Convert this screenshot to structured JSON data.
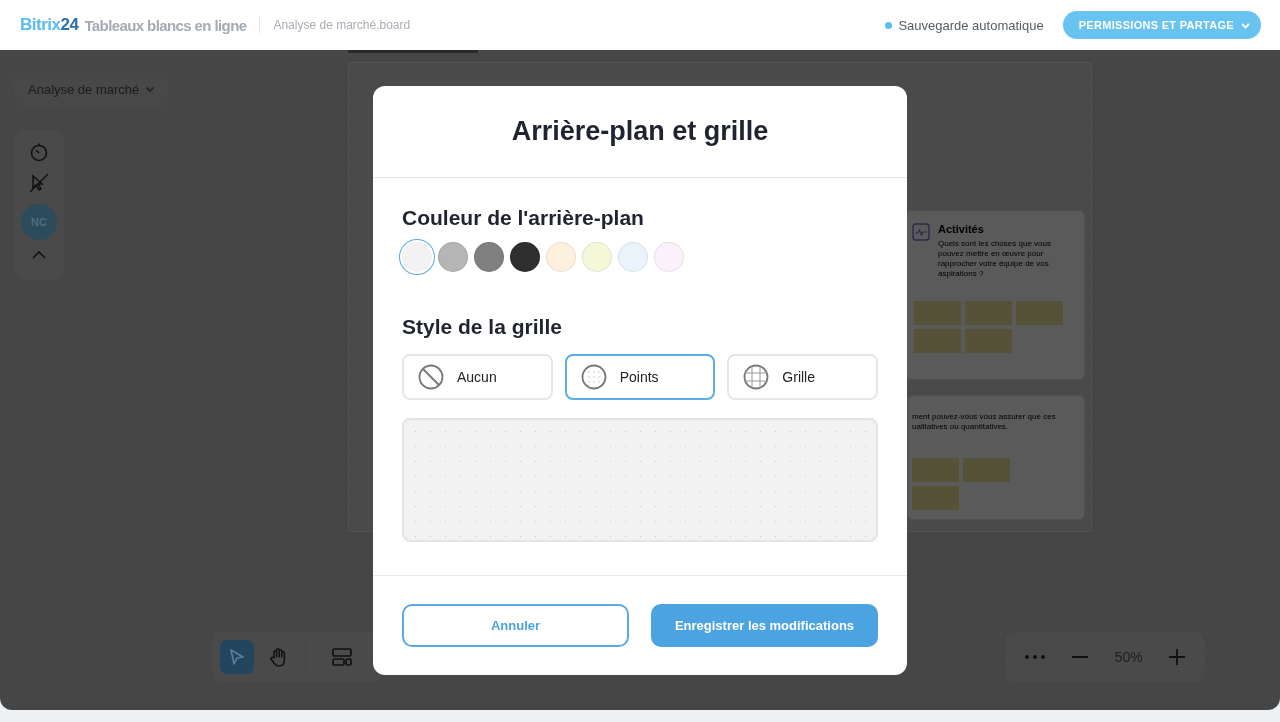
{
  "header": {
    "logo": {
      "brand": "Bitrix",
      "number": "24"
    },
    "app_name": "Tableaux blancs en ligne",
    "file_name": "Analyse de marché.board",
    "save_status": {
      "label": "Sauvegarde automatique",
      "color": "#5bc0f0"
    },
    "share_button": "PERMISSIONS ET PARTAGE"
  },
  "board": {
    "title": "Analyse de marché",
    "avatar": "NC",
    "zoom": "50%",
    "tools": [
      {
        "kind": "select",
        "selected": true
      },
      {
        "kind": "hand",
        "selected": false
      },
      {
        "kind": "layout",
        "selected": false
      }
    ],
    "cards": [
      {
        "title": "Activités",
        "text": "Quels sont les choses que vous pouvez mettre en œuvre pour rapprocher votre équipe de vos aspirations ?"
      },
      {
        "text_lines": [
          "ment pouvez-vous vous assurer que ces",
          "ualitatives ou quantitatives."
        ]
      }
    ]
  },
  "dialog": {
    "title": "Arrière-plan et grille",
    "background": {
      "heading": "Couleur de l'arrière-plan",
      "colors": [
        {
          "color": "#f2f2f2",
          "selected": true
        },
        {
          "color": "#b5b5b5",
          "selected": false
        },
        {
          "color": "#808080",
          "selected": false
        },
        {
          "color": "#2e2e2e",
          "selected": false
        },
        {
          "color": "#fdf0dd",
          "selected": false
        },
        {
          "color": "#f5f7d9",
          "selected": false
        },
        {
          "color": "#eaf3fc",
          "selected": false
        },
        {
          "color": "#fbf1fa",
          "selected": false
        }
      ]
    },
    "grid": {
      "heading": "Style de la grille",
      "options": [
        {
          "kind": "none",
          "label": "Aucun",
          "selected": false
        },
        {
          "kind": "points",
          "label": "Points",
          "selected": true
        },
        {
          "kind": "grid",
          "label": "Grille",
          "selected": false
        }
      ]
    },
    "cancel_button": "Annuler",
    "save_button": "Enregistrer les modifications"
  }
}
